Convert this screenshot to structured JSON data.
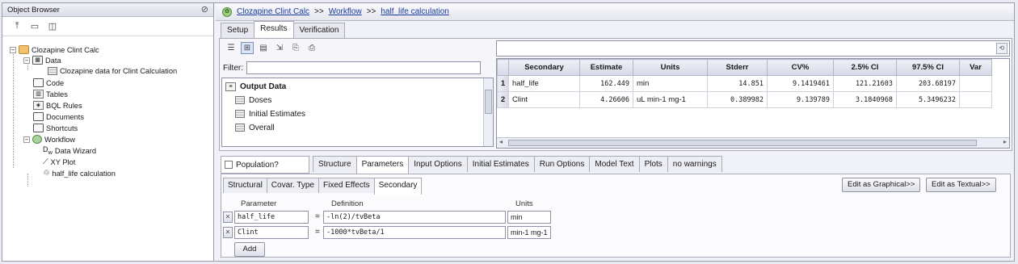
{
  "object_browser": {
    "title": "Object Browser",
    "pin_glyph": "⊘",
    "tree": {
      "project": "Clozapine Clint Calc",
      "data": "Data",
      "data_item": "Clozapine data for Clint Calculation",
      "code": "Code",
      "tables": "Tables",
      "bql": "BQL Rules",
      "documents": "Documents",
      "shortcuts": "Shortcuts",
      "workflow": "Workflow",
      "wizard": "Data Wizard",
      "xyplot": "XY Plot",
      "half_life": "half_life calculation"
    }
  },
  "breadcrumb": {
    "project": "Clozapine Clint Calc",
    "sep": ">>",
    "workflow": "Workflow",
    "current": "half_life calculation"
  },
  "main_tabs": [
    "Setup",
    "Results",
    "Verification"
  ],
  "filter_label": "Filter:",
  "output": {
    "header": "Output Data",
    "items": [
      "Doses",
      "Initial Estimates",
      "Overall"
    ]
  },
  "results_table": {
    "columns": [
      "Secondary",
      "Estimate",
      "Units",
      "Stderr",
      "CV%",
      "2.5% CI",
      "97.5% CI",
      "Var"
    ],
    "rows": [
      {
        "n": "1",
        "cells": [
          "half_life",
          "162.449",
          "min",
          "14.851",
          "9.1419461",
          "121.21603",
          "203.68197",
          ""
        ]
      },
      {
        "n": "2",
        "cells": [
          "Clint",
          "4.26606",
          "uL min-1 mg-1",
          "0.389982",
          "9.139789",
          "3.1840968",
          "5.3496232",
          ""
        ]
      }
    ]
  },
  "population_label": "Population?",
  "model_tabs": [
    "Structure",
    "Parameters",
    "Input Options",
    "Initial Estimates",
    "Run Options",
    "Model Text",
    "Plots",
    "no warnings"
  ],
  "param_tabs": [
    "Structural",
    "Covar. Type",
    "Fixed Effects",
    "Secondary"
  ],
  "edit_graphical": "Edit as Graphical>>",
  "edit_textual": "Edit as Textual>>",
  "param_headers": {
    "parameter": "Parameter",
    "definition": "Definition",
    "units": "Units"
  },
  "params": [
    {
      "name": "half_life",
      "definition": "-ln(2)/tvBeta",
      "units": "min"
    },
    {
      "name": "Clint",
      "definition": "-1000*tvBeta/1",
      "units": "min-1 mg-1"
    }
  ],
  "add_label": "Add"
}
